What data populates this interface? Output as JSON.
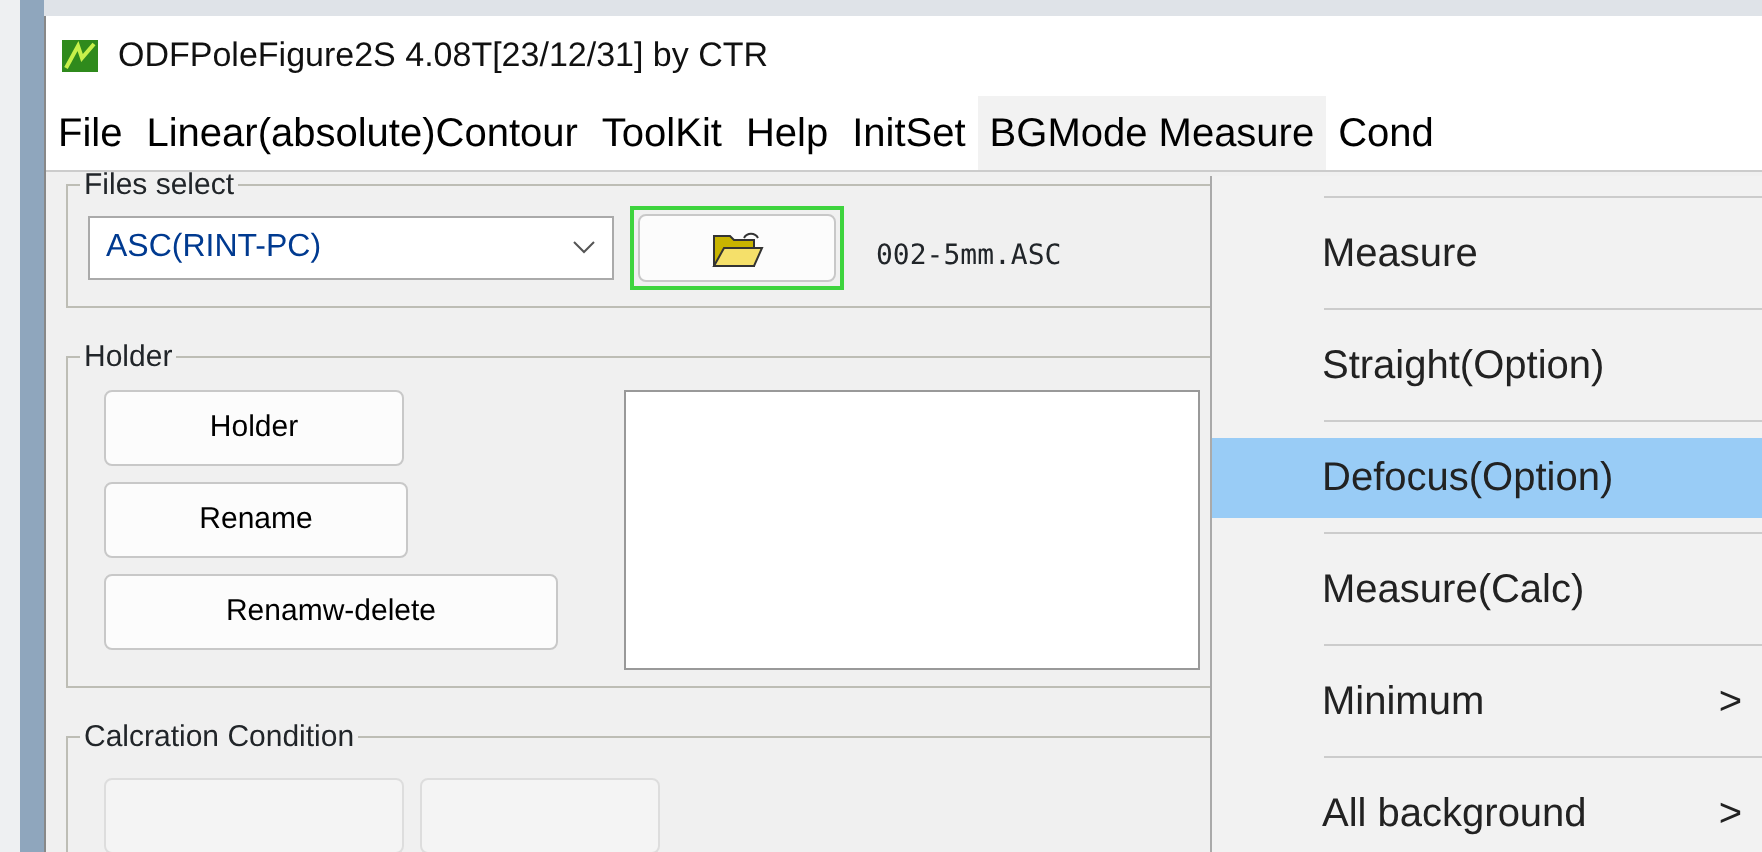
{
  "window": {
    "title": "ODFPoleFigure2S 4.08T[23/12/31] by CTR"
  },
  "menu_bar": [
    {
      "label": "File",
      "selected": false
    },
    {
      "label": "Linear(absolute)Contour",
      "selected": false
    },
    {
      "label": "ToolKit",
      "selected": false
    },
    {
      "label": "Help",
      "selected": false
    },
    {
      "label": "InitSet",
      "selected": false
    },
    {
      "label": "BGMode Measure",
      "selected": true
    },
    {
      "label": "Cond",
      "selected": false
    }
  ],
  "files_select": {
    "title": "Files select",
    "format": "ASC(RINT-PC)",
    "file_name": "002-5mm.ASC"
  },
  "holder": {
    "title": "Holder",
    "buttons": [
      "Holder",
      "Rename",
      "Renamw-delete"
    ]
  },
  "calc_condition": {
    "title": "Calcration Condition",
    "buttons": [
      {
        "disabled": true
      },
      {
        "disabled": true
      }
    ]
  },
  "dropdown_menu": [
    {
      "label": "Measure",
      "selected": false
    },
    {
      "label": "Straight(Option)",
      "selected": false
    },
    {
      "label": "Defocus(Option)",
      "selected": true
    },
    {
      "label": "Measure(Calc)",
      "selected": false
    },
    {
      "label": "Minimum",
      "selected": false,
      "submenu": ">"
    },
    {
      "label": "All background",
      "selected": false,
      "submenu": ">"
    }
  ]
}
